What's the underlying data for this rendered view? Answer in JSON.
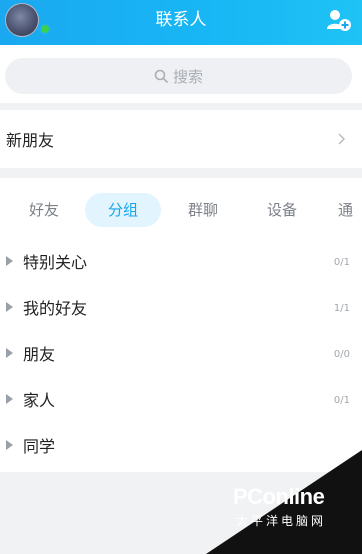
{
  "header": {
    "title": "联系人",
    "avatar_icon": "user-avatar",
    "status": "online",
    "add_icon": "add-contact-icon"
  },
  "search": {
    "placeholder": "搜索",
    "icon": "search-icon"
  },
  "new_friends": {
    "label": "新朋友",
    "icon": "chevron-right-icon"
  },
  "tabs": [
    {
      "label": "好友",
      "active": false
    },
    {
      "label": "分组",
      "active": true
    },
    {
      "label": "群聊",
      "active": false
    },
    {
      "label": "设备",
      "active": false
    },
    {
      "label": "通",
      "active": false
    }
  ],
  "groups": [
    {
      "name": "特别关心",
      "count": "0/1"
    },
    {
      "name": "我的好友",
      "count": "1/1"
    },
    {
      "name": "朋友",
      "count": "0/0"
    },
    {
      "name": "家人",
      "count": "0/1"
    },
    {
      "name": "同学",
      "count": ""
    }
  ],
  "watermark": {
    "brand": "PConline",
    "subtitle": "太平洋电脑网"
  },
  "colors": {
    "header": "#18b7f5",
    "accent": "#15a6ef",
    "online": "#3ad14f"
  }
}
